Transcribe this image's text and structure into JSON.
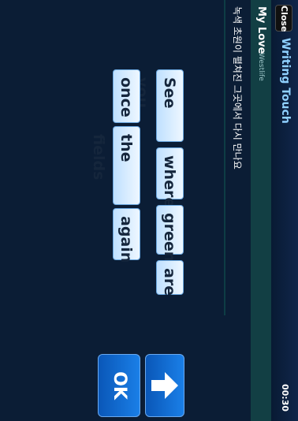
{
  "header": {
    "close_label": "Close",
    "title": "Writing Touch",
    "time": "00:30"
  },
  "song": {
    "title": "My Love",
    "artist": "Westlife"
  },
  "lyric": "녹색 초원이 펼쳐진 그곳에서 다시 만나요",
  "word_chips": [
    "See you",
    "where",
    "green",
    "are",
    "once",
    "the fields",
    "again"
  ],
  "buttons": {
    "up_icon": "up-arrow-icon",
    "ok_label": "OK"
  },
  "colors": {
    "accent": "#0a57b8",
    "chip_bg": "#cfe8ff",
    "background": "#0b1d35"
  }
}
